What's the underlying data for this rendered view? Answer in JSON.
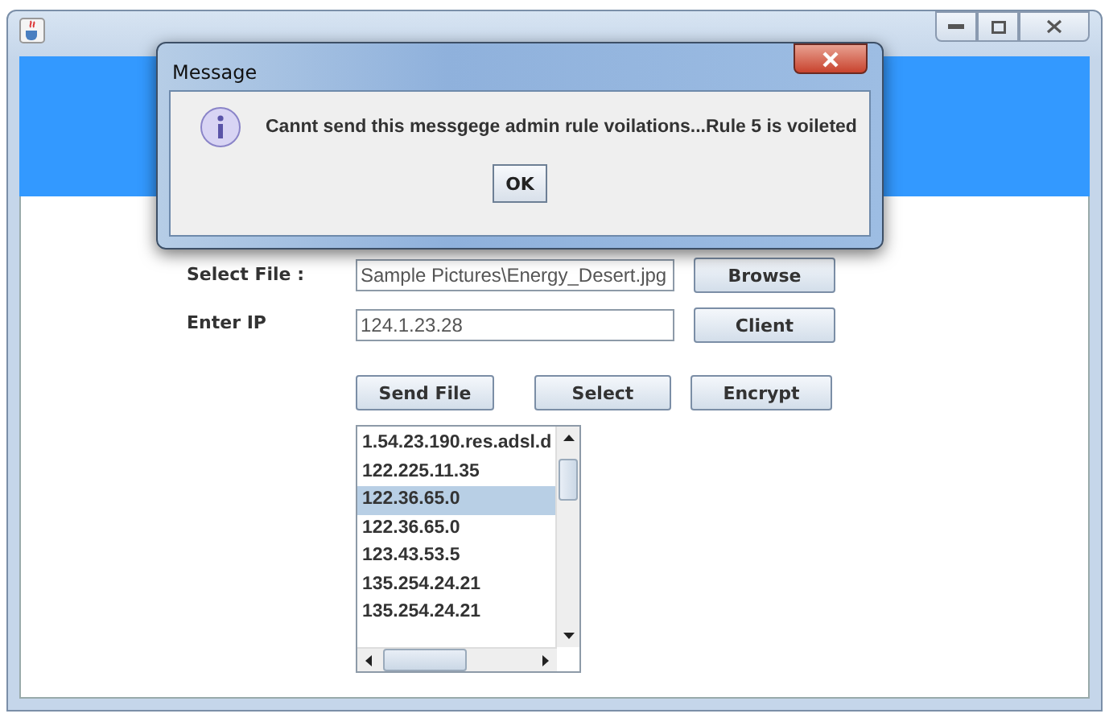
{
  "form": {
    "file_label": "Select File :",
    "file_value": "Sample Pictures\\Energy_Desert.jpg",
    "browse": "Browse",
    "ip_label": "Enter IP",
    "ip_value": "124.1.23.28",
    "client": "Client",
    "actions": [
      "Send File",
      "Select",
      "Encrypt"
    ]
  },
  "ip_list": [
    {
      "text": "1.54.23.190.res.adsl.d",
      "selected": false
    },
    {
      "text": "122.225.11.35",
      "selected": false
    },
    {
      "text": "122.36.65.0",
      "selected": true
    },
    {
      "text": "122.36.65.0",
      "selected": false
    },
    {
      "text": "123.43.53.5",
      "selected": false
    },
    {
      "text": "135.254.24.21",
      "selected": false
    },
    {
      "text": "135.254.24.21",
      "selected": false
    }
  ],
  "dialog": {
    "title": "Message",
    "message": "Cannt send this messgege admin rule voilations...Rule 5 is voileted",
    "ok": "OK"
  }
}
